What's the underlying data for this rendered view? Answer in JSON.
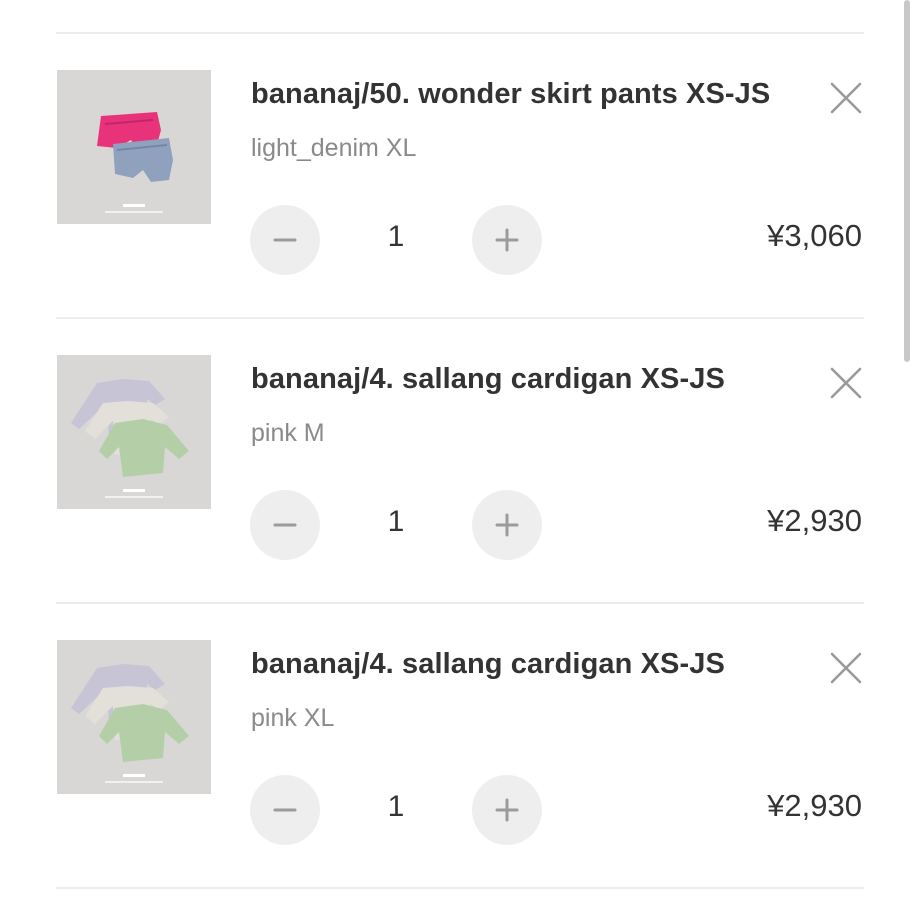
{
  "cart": {
    "items": [
      {
        "title": "bananaj/50. wonder skirt pants XS-JS",
        "variant": "light_denim XL",
        "quantity": "1",
        "price": "¥3,060",
        "image_icon": "skirt-pants-thumbnail"
      },
      {
        "title": "bananaj/4. sallang cardigan XS-JS",
        "variant": "pink M",
        "quantity": "1",
        "price": "¥2,930",
        "image_icon": "cardigan-thumbnail"
      },
      {
        "title": "bananaj/4. sallang cardigan XS-JS",
        "variant": "pink XL",
        "quantity": "1",
        "price": "¥2,930",
        "image_icon": "cardigan-thumbnail"
      }
    ],
    "icons": {
      "remove": "close-icon",
      "decrement": "minus-icon",
      "increment": "plus-icon"
    },
    "colors": {
      "text": "#333333",
      "variant_text": "#8a8a8a",
      "button_bg": "#eeeeee",
      "divider": "#ececec"
    }
  }
}
